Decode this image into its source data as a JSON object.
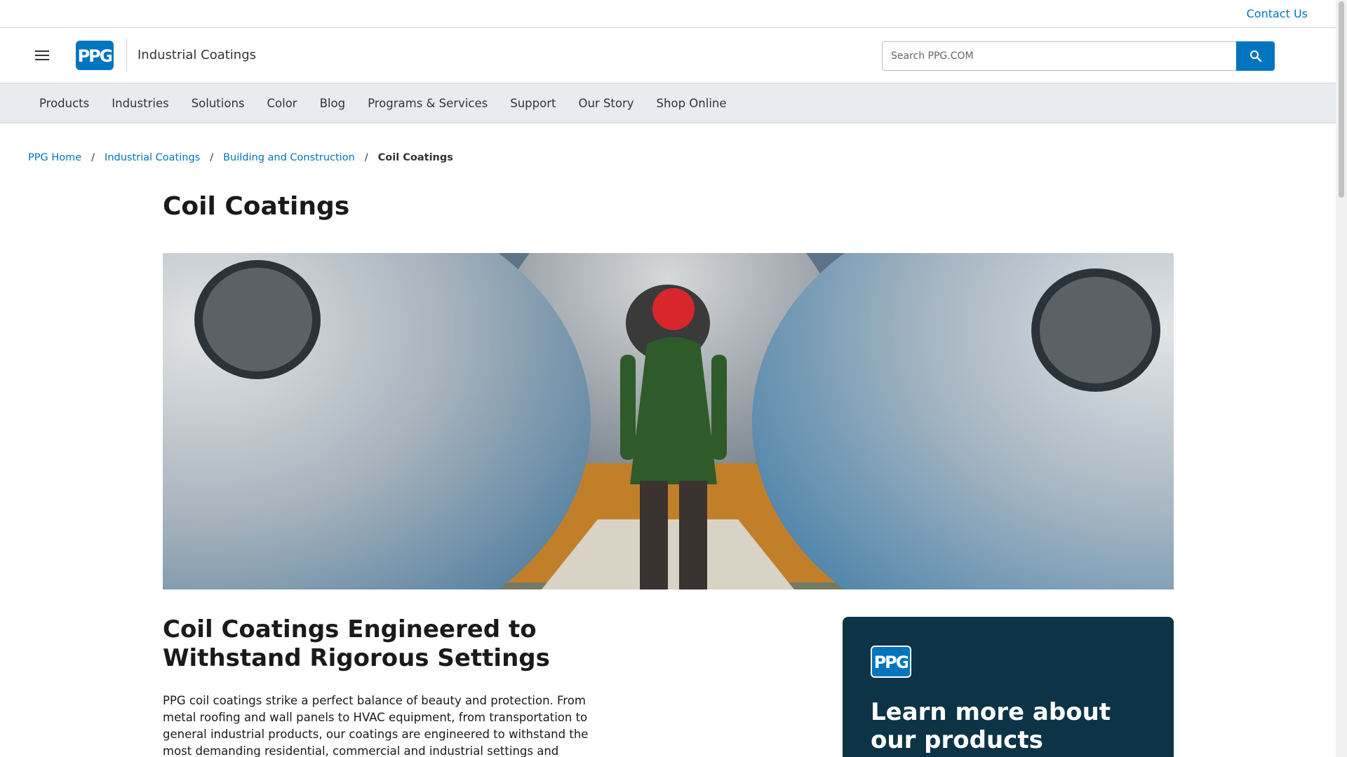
{
  "utility": {
    "contact_label": "Contact Us"
  },
  "header": {
    "site_name": "Industrial Coatings",
    "logo_text": "PPG",
    "search_placeholder": "Search PPG.COM"
  },
  "nav": {
    "items": [
      {
        "label": "Products"
      },
      {
        "label": "Industries"
      },
      {
        "label": "Solutions"
      },
      {
        "label": "Color"
      },
      {
        "label": "Blog"
      },
      {
        "label": "Programs & Services"
      },
      {
        "label": "Support"
      },
      {
        "label": "Our Story"
      },
      {
        "label": "Shop Online"
      }
    ]
  },
  "breadcrumb": {
    "items": [
      {
        "label": "PPG Home"
      },
      {
        "label": "Industrial Coatings"
      },
      {
        "label": "Building and Construction"
      }
    ],
    "current": "Coil Coatings"
  },
  "main": {
    "title": "Coil Coatings",
    "section_heading": "Coil Coatings Engineered to Withstand Rigorous Settings",
    "body": "PPG coil coatings strike a perfect balance of beauty and protection. From metal roofing and wall panels to HVAC equipment, from transportation to general industrial products, our coatings are engineered to withstand the most demanding residential, commercial and industrial settings and environmental conditions."
  },
  "cta_card": {
    "title": "Learn more about our products"
  },
  "colors": {
    "brand_blue": "#0075bf",
    "card_navy": "#0d3446",
    "nav_bg": "#e8ecf0"
  },
  "icons": {
    "menu": "hamburger-menu-icon",
    "search": "search-icon",
    "logo": "ppg-logo"
  }
}
